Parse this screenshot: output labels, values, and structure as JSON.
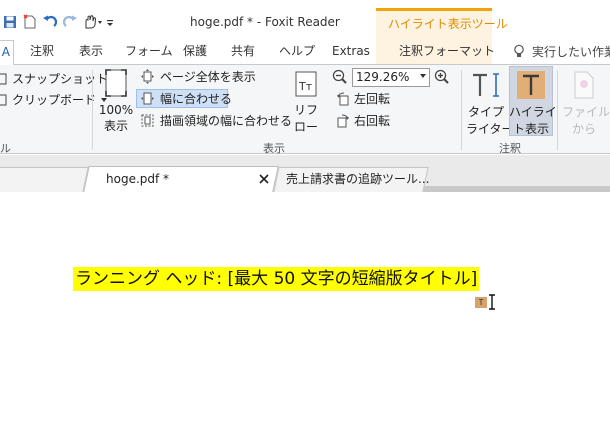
{
  "window": {
    "title": "hoge.pdf * - Foxit Reader",
    "context_group_label": "ハイライト表示ツール"
  },
  "tabs": [
    "A",
    "注釈",
    "表示",
    "フォーム",
    "保護",
    "共有",
    "ヘルプ",
    "Extras",
    "注釈フォーマット"
  ],
  "tell_me": "実行したい作業",
  "ribbon": {
    "snapshot": "スナップショット",
    "clipboard": "クリップボード",
    "zoom_100_line1": "100%",
    "zoom_100_line2": "表示",
    "fit_page": "ページ全体を表示",
    "fit_width": "幅に合わせる",
    "fit_visible": "描画領域の幅に合わせる",
    "reflow_line1": "リフ",
    "reflow_line2": "ロー",
    "zoom_value": "129.26%",
    "rotate_left": "左回転",
    "rotate_right": "右回転",
    "typewriter_line1": "タイプ",
    "typewriter_line2": "ライター",
    "highlight_line1": "ハイライ",
    "highlight_line2": "ト表示",
    "file_attach_line1": "ファイル",
    "file_attach_line2": "から",
    "group_left_partial": "ル",
    "group_view": "表示",
    "group_annotation": "注釈"
  },
  "doc_tabs": {
    "active": "hoge.pdf *",
    "second": "売上請求書の追跡ツール..."
  },
  "document": {
    "highlighted_text": "ランニング ヘッド: [最大 50 文字の短縮版タイトル]",
    "cursor_badge": "T"
  },
  "colors": {
    "highlight": "#ffff00",
    "context_accent": "#f0a30a",
    "selected_button": "#cde0f5"
  }
}
